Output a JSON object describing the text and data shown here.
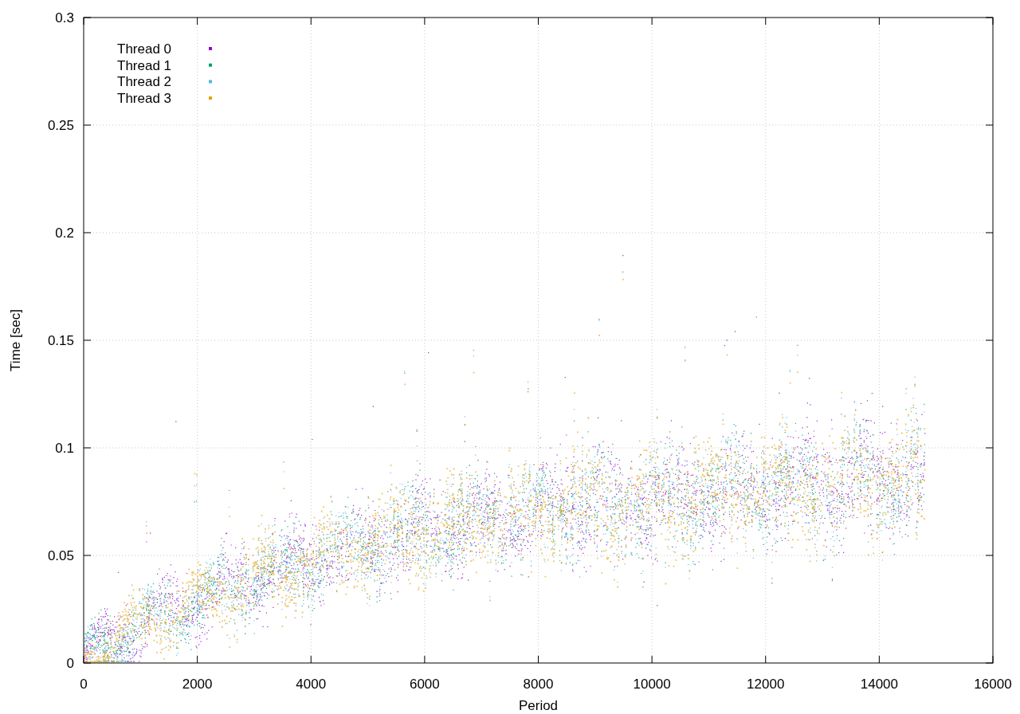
{
  "plot": {
    "y_axis_title": "Time [sec]",
    "x_axis_title": "Period",
    "y_ticks": [
      "0.3",
      "0.25",
      "0.2",
      "0.15",
      "0.1",
      "0.05",
      "0"
    ],
    "x_ticks": [
      "0",
      "2000",
      "4000",
      "6000",
      "8000",
      "10000",
      "12000",
      "14000",
      "16000"
    ],
    "legend": [
      {
        "label": "Thread 0",
        "color": "#9400d3"
      },
      {
        "label": "Thread 1",
        "color": "#009e73"
      },
      {
        "label": "Thread 2",
        "color": "#56b4e9"
      },
      {
        "label": "Thread 3",
        "color": "#e69f00"
      }
    ]
  }
}
